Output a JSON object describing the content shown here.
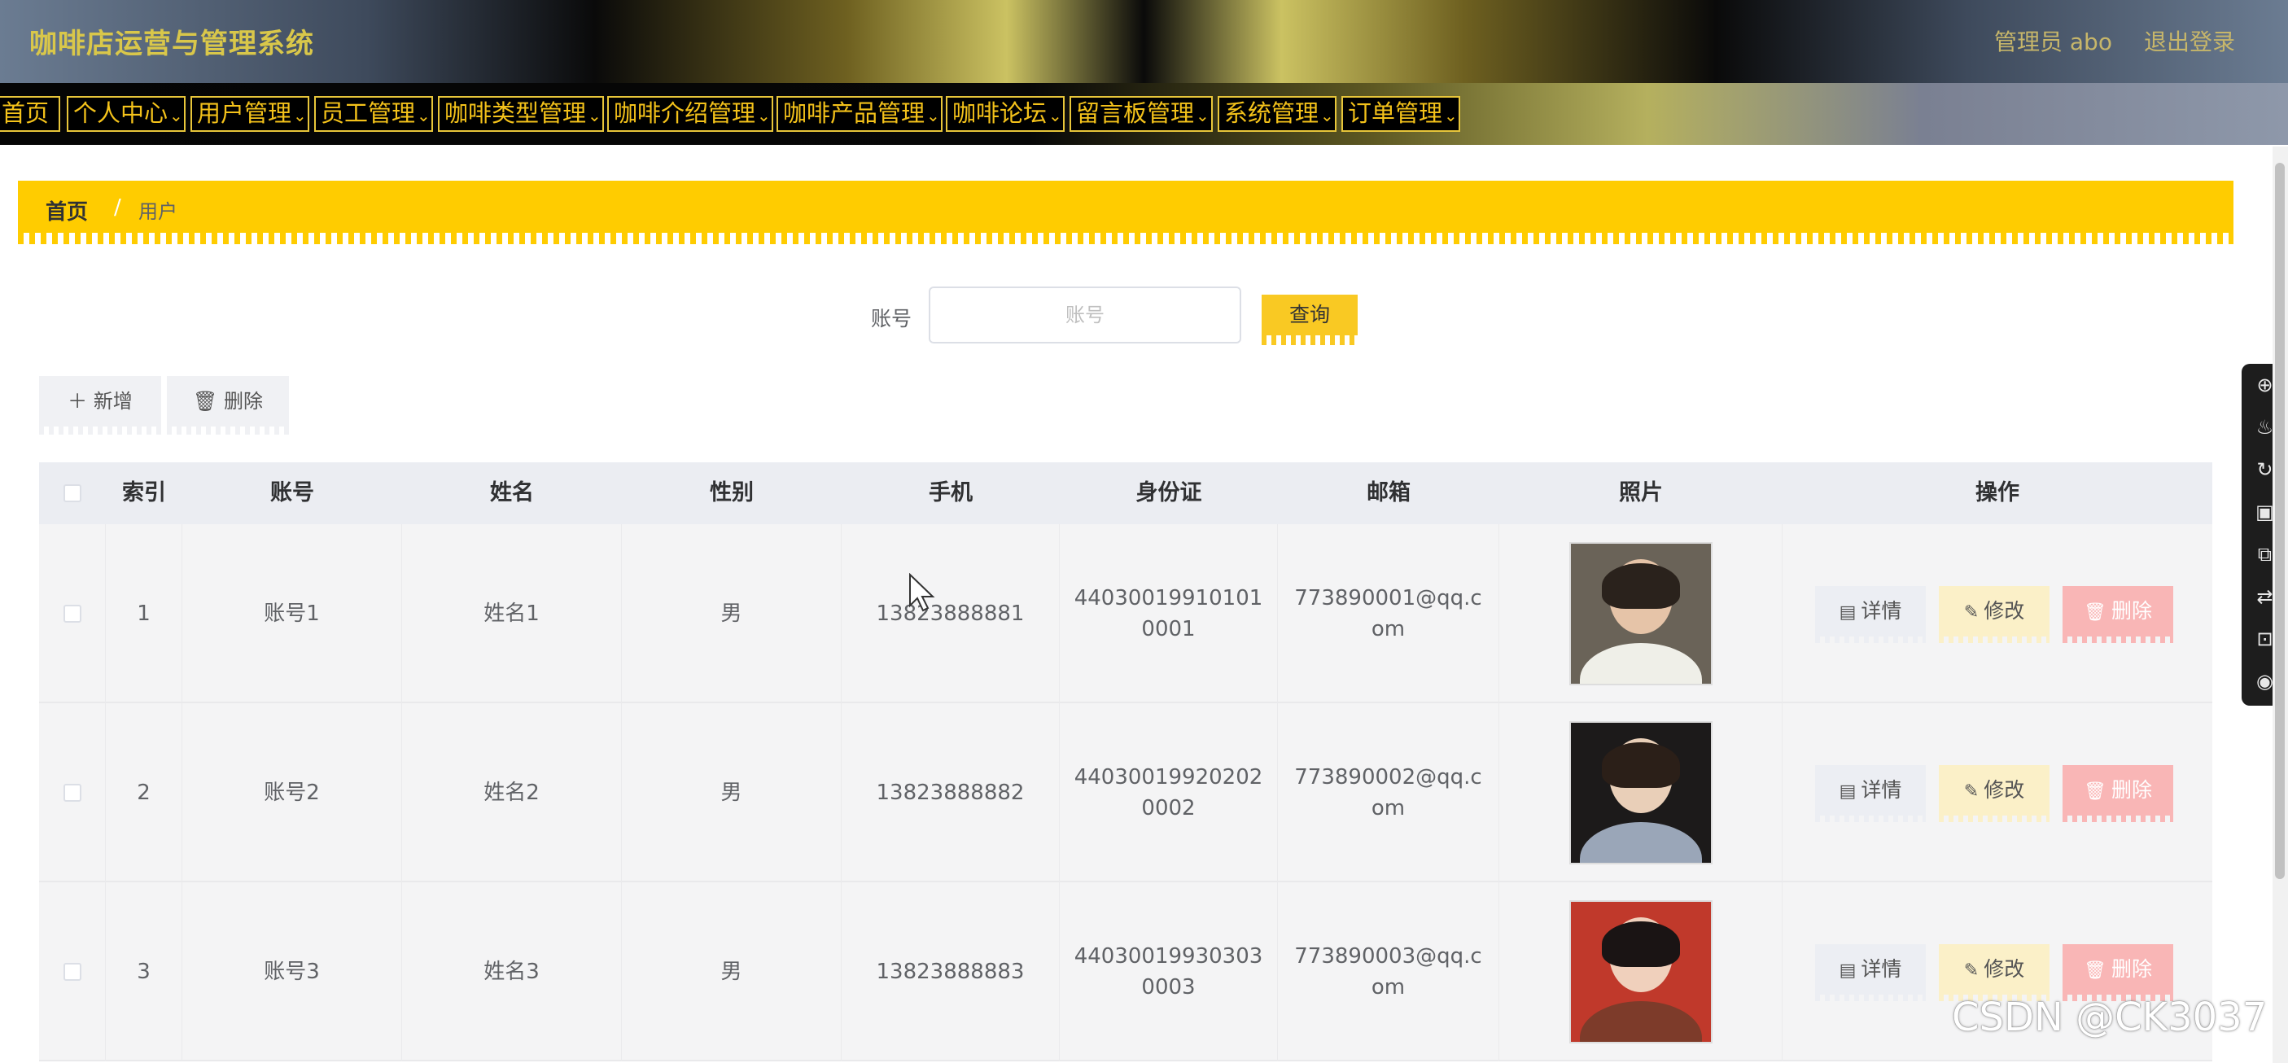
{
  "header": {
    "title": "咖啡店运营与管理系统",
    "user_label": "管理员 abo",
    "logout_label": "退出登录"
  },
  "nav": {
    "items": [
      {
        "label": "首页",
        "has_arrow": false
      },
      {
        "label": "个人中心",
        "has_arrow": true
      },
      {
        "label": "用户管理",
        "has_arrow": true
      },
      {
        "label": "员工管理",
        "has_arrow": true
      },
      {
        "label": "咖啡类型管理",
        "has_arrow": true
      },
      {
        "label": "咖啡介绍管理",
        "has_arrow": true
      },
      {
        "label": "咖啡产品管理",
        "has_arrow": true
      },
      {
        "label": "咖啡论坛",
        "has_arrow": true
      },
      {
        "label": "留言板管理",
        "has_arrow": true
      },
      {
        "label": "系统管理",
        "has_arrow": true
      },
      {
        "label": "订单管理",
        "has_arrow": true
      }
    ]
  },
  "breadcrumb": {
    "home": "首页",
    "separator": "/",
    "current": "用户"
  },
  "search": {
    "label": "账号",
    "placeholder": "账号",
    "value": "",
    "query_label": "查询"
  },
  "toolbar": {
    "add_label": "新增",
    "delete_label": "删除"
  },
  "table": {
    "columns": [
      "索引",
      "账号",
      "姓名",
      "性别",
      "手机",
      "身份证",
      "邮箱",
      "照片",
      "操作"
    ],
    "rows": [
      {
        "index": "1",
        "account": "账号1",
        "name": "姓名1",
        "gender": "男",
        "phone": "13823888881",
        "id_card": "440300199101010001",
        "email": "773890001@qq.com",
        "photo": {
          "bg": "#6a6358",
          "skin": "#e6c4a8",
          "hair": "#2a221c",
          "shirt": "#efefe8"
        }
      },
      {
        "index": "2",
        "account": "账号2",
        "name": "姓名2",
        "gender": "男",
        "phone": "13823888882",
        "id_card": "440300199202020002",
        "email": "773890002@qq.com",
        "photo": {
          "bg": "#1c1a1a",
          "skin": "#e9cfb8",
          "hair": "#2b1f18",
          "shirt": "#9aa6b8"
        }
      },
      {
        "index": "3",
        "account": "账号3",
        "name": "姓名3",
        "gender": "男",
        "phone": "13823888883",
        "id_card": "440300199303030003",
        "email": "773890003@qq.com",
        "photo": {
          "bg": "#c0392b",
          "skin": "#f0d0bc",
          "hair": "#1a1414",
          "shirt": "#7d3b2a"
        }
      }
    ],
    "actions": {
      "detail_label": "详情",
      "edit_label": "修改",
      "delete_label": "删除"
    }
  },
  "floating_toolbar": {
    "icons": [
      "zoom-icon",
      "fire-icon",
      "refresh-icon",
      "video-icon",
      "screen-record-icon",
      "swap-icon",
      "translate-icon",
      "camera-icon"
    ]
  },
  "watermark": "CSDN @CK3037",
  "colors": {
    "accent_yellow": "#ffcc00",
    "nav_text": "#f4c21a",
    "edit_bg": "#fbf0c8",
    "delete_bg": "#f9b6b6",
    "detail_bg": "#eceef3"
  }
}
